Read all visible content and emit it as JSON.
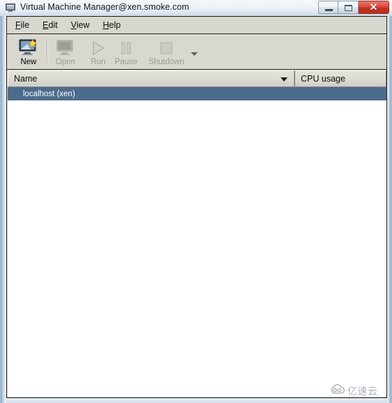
{
  "window": {
    "title": "Virtual Machine Manager@xen.smoke.com",
    "icon": "computer-icon",
    "controls": {
      "minimize_label": "–",
      "maximize_label": "□",
      "close_label": "✕"
    }
  },
  "menubar": {
    "items": [
      {
        "accel": "F",
        "rest": "ile"
      },
      {
        "accel": "E",
        "rest": "dit"
      },
      {
        "accel": "V",
        "rest": "iew"
      },
      {
        "accel": "H",
        "rest": "elp"
      }
    ]
  },
  "toolbar": {
    "items": [
      {
        "label": "New",
        "icon": "monitor-new-icon",
        "enabled": true
      },
      {
        "label": "Open",
        "icon": "monitor-open-icon",
        "enabled": false
      },
      {
        "label": "Run",
        "icon": "play-icon",
        "enabled": false
      },
      {
        "label": "Pause",
        "icon": "pause-icon",
        "enabled": false
      },
      {
        "label": "Shutdown",
        "icon": "shutdown-icon",
        "enabled": false
      }
    ],
    "overflow_icon": "chevron-down-icon"
  },
  "list": {
    "columns": [
      {
        "key": "name",
        "label": "Name",
        "sorted": true,
        "sort_icon": "sort-descending-icon"
      },
      {
        "key": "cpu",
        "label": "CPU usage",
        "sorted": false
      }
    ],
    "rows": [
      {
        "name": "localhost (xen)",
        "cpu": "",
        "selected": true
      }
    ]
  },
  "watermark": {
    "text": "亿速云",
    "icon": "cloud-icon"
  },
  "colors": {
    "selection": "#4c6c8c",
    "chrome": "#d9d8d0",
    "close_button": "#c53122",
    "accent_star": "#ffd24d"
  }
}
